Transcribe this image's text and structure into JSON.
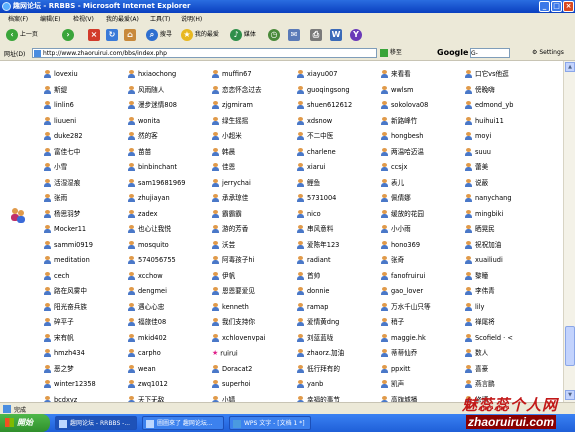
{
  "window": {
    "title": "趣网论坛 - RRBBS - Microsoft Internet Explorer",
    "buttons": [
      "minimize",
      "maximize",
      "close"
    ]
  },
  "menubar": {
    "items": [
      "档案(F)",
      "编辑(E)",
      "检视(V)",
      "我的最爱(A)",
      "工具(T)",
      "说明(H)"
    ]
  },
  "toolbar": {
    "back_label": "上一页",
    "search_label": "搜寻",
    "favorites_label": "我的最爱",
    "media_label": "媒体"
  },
  "addressbar": {
    "label": "网址(D)",
    "url": "http://www.zhaoruirui.com/bbs/index.php",
    "go_label": "移至",
    "search_engine": "Google",
    "search_value": "G-",
    "settings_label": "Settings"
  },
  "users": {
    "col1": [
      "lovexiu",
      "斯缇",
      "linlin6",
      "liuueni",
      "duke282",
      "富佳七中",
      "小雪",
      "活湿湿痕",
      "张雨",
      "杨思羽梦",
      "Mocker11",
      "sammi0919",
      "meditation",
      "cech",
      "路在风雾中",
      "阳光奋兵族",
      "碎平子",
      "宋有帆",
      "hmzh434",
      "恶之梦",
      "winter12358",
      "bcdxyz"
    ],
    "col2": [
      "hxiaochong",
      "风雨随人",
      "漫步迷情808",
      "wonita",
      "然的客",
      "苗苗",
      "binbinchant",
      "sam19681969",
      "zhujiayan",
      "zadex",
      "也心让我悦",
      "mosquito",
      "574056755",
      "xcchow",
      "dengmei",
      "遇心心忠",
      "福旅佳08",
      "mkid402",
      "carpho",
      "wean",
      "zwq1012",
      "天下无敌"
    ],
    "col3": [
      "muffin67",
      "恋恋怀念过去",
      "zjgmiram",
      "绿生摇摇",
      "小超米",
      "韩晨",
      "佳恩",
      "jerrychai",
      "承承琼佳",
      "霸霸霸",
      "游的芳香",
      "沃芸",
      "阿毒孩子hi",
      "伊帆",
      "恩恩要爱见",
      "kenneth",
      "我们支持你",
      "xchlovenvpai",
      "ruirui",
      "Doracat2",
      "superhoi",
      "小婧"
    ],
    "col4": [
      "xiayu007",
      "guoqingsong",
      "shuen612612",
      "xdsnow",
      "不二中医",
      "charlene",
      "xiarui",
      "鲤鱼",
      "5731004",
      "nico",
      "串风意料",
      "爱陈年123",
      "radiant",
      "首帅",
      "donnie",
      "ramap",
      "爱情黄dng",
      "刘蓝蓝咙",
      "zhaorz.加油",
      "低行拜有的",
      "yanb",
      "幸福的事节"
    ],
    "col5": [
      "来看看",
      "wwlsm",
      "sokolova08",
      "新路峰竹",
      "hongbesh",
      "两温哈迈温",
      "ccsjx",
      "表儿",
      "佩倩娜",
      "缓放的花园",
      "小小雨",
      "hono369",
      "张奇",
      "fanofruirui",
      "gao_lover",
      "万水千山只等",
      "稍子",
      "maggie.hk",
      "蒂蒂仙乔",
      "ppxitt",
      "凯声",
      "高旗城播"
    ],
    "col6": [
      "口它vs他逛",
      "傍晚嗨",
      "edmond_yb",
      "huihui11",
      "moyi",
      "suuu",
      "蕾美",
      "说蔽",
      "nanychang",
      "mingbiki",
      "晒晃民",
      "祝祝加油",
      "xuailiudi",
      "黎瞳",
      "李伟青",
      "lily",
      "禅尾将",
      "Scofield ·  <",
      "数人",
      "喜豪",
      "燕言鹏",
      "修博"
    ]
  },
  "special_icons": {
    "ruirui": "star-icon"
  },
  "statusbar": {
    "status_text": "完成"
  },
  "taskbar": {
    "start_label": "開始",
    "tasks": [
      "趣网论坛 - RRBBS -...",
      "圖圖來了 趣网论坛...",
      "WPS 文字 - [文档 1 *]"
    ]
  },
  "watermark": {
    "title": "魅蕊蕊个人网",
    "url": "zhaoruirui.com"
  }
}
